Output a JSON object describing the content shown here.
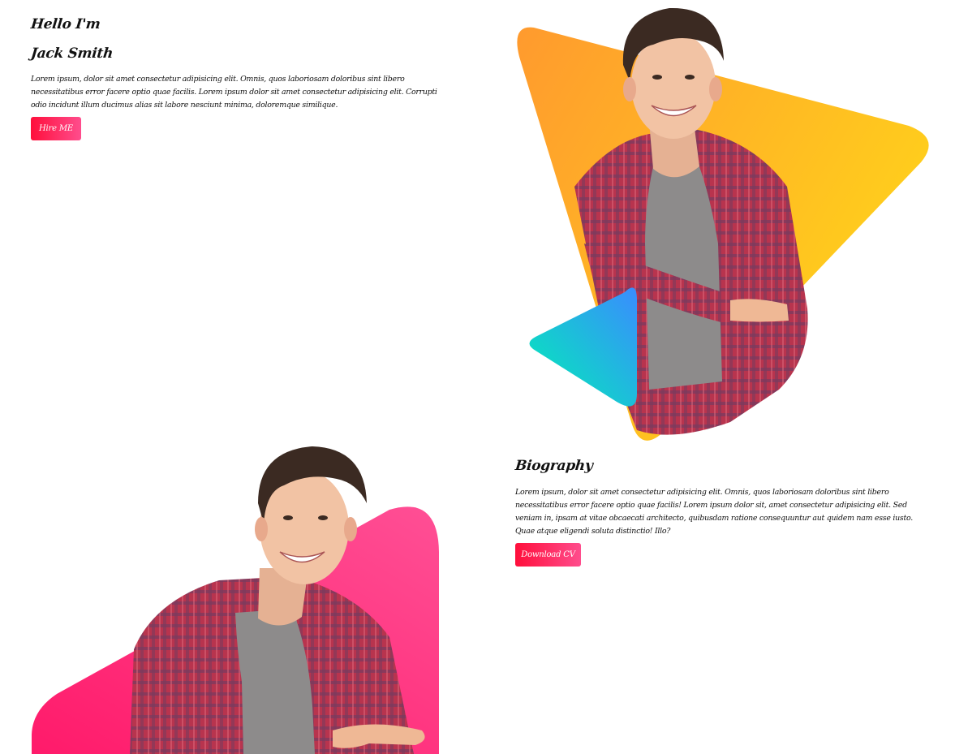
{
  "hero": {
    "greeting": "Hello I'm",
    "name": "Jack Smith",
    "description": "Lorem ipsum, dolor sit amet consectetur adipisicing elit. Omnis, quos laboriosam doloribus sint libero necessitatibus error facere optio quae facilis. Lorem ipsum dolor sit amet consectetur adipisicing elit. Corrupti odio incidunt illum ducimus alias sit labore nesciunt minima, doloremque similique.",
    "button_label": "Hire ME",
    "photo_icon": "portrait-photo",
    "colors": {
      "triangle_start": "#ff9a2e",
      "triangle_end": "#ffd41a",
      "small_triangle_start": "#00f0b5",
      "small_triangle_end": "#3a8cff"
    }
  },
  "biography": {
    "title": "Biography",
    "description": "Lorem ipsum, dolor sit amet consectetur adipisicing elit. Omnis, quos laboriosam doloribus sint libero necessitatibus error facere optio quae facilis! Lorem ipsum dolor sit, amet consectetur adipisicing elit. Sed veniam in, ipsam at vitae obcaecati architecto, quibusdam ratione consequuntur aut quidem nam esse iusto. Quae atque eligendi soluta distinctio! Illo?",
    "button_label": "Download CV",
    "photo_icon": "portrait-photo",
    "colors": {
      "shape_start": "#ff1a6a",
      "shape_end": "#ff4f95"
    }
  },
  "button_colors": {
    "start": "#ff0f3b",
    "end": "#ff4d8d"
  }
}
